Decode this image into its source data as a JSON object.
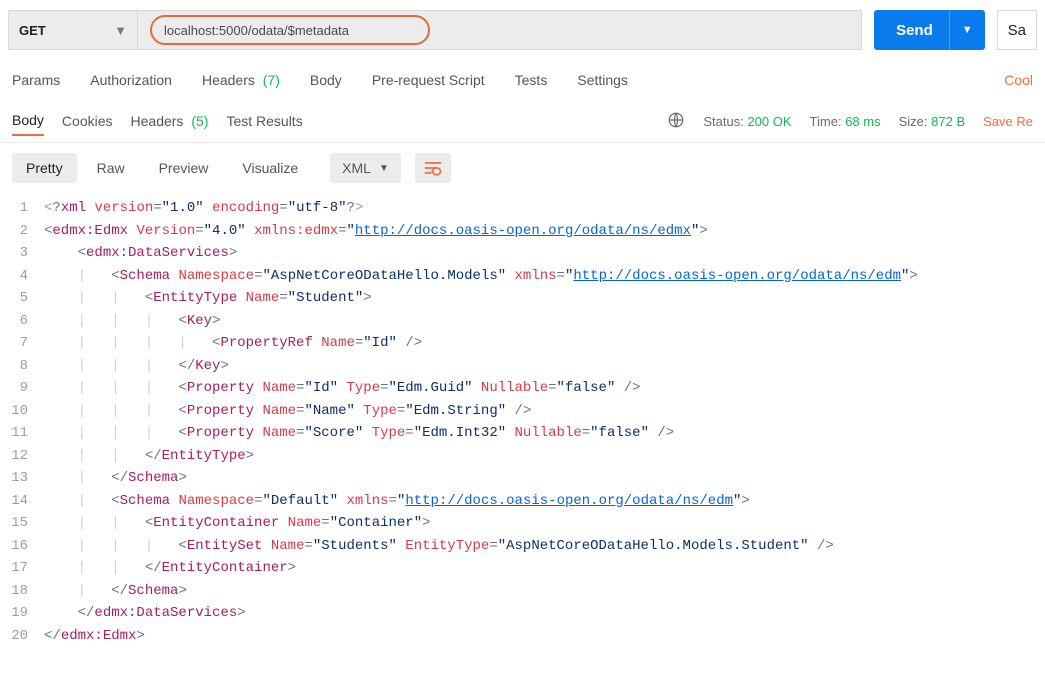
{
  "request": {
    "method": "GET",
    "url": "localhost:5000/odata/$metadata",
    "send_label": "Send",
    "save_label": "Sa"
  },
  "req_tabs": {
    "params": "Params",
    "auth": "Authorization",
    "headers": "Headers",
    "headers_count": "(7)",
    "body": "Body",
    "prereq": "Pre-request Script",
    "tests": "Tests",
    "settings": "Settings",
    "cookies_link": "Cool"
  },
  "res_tabs": {
    "body": "Body",
    "cookies": "Cookies",
    "headers": "Headers",
    "headers_count": "(5)",
    "test_results": "Test Results"
  },
  "res_meta": {
    "status_label": "Status:",
    "status_value": "200 OK",
    "time_label": "Time:",
    "time_value": "68 ms",
    "size_label": "Size:",
    "size_value": "872 B",
    "save_res": "Save Re"
  },
  "res_view": {
    "pretty": "Pretty",
    "raw": "Raw",
    "preview": "Preview",
    "visualize": "Visualize",
    "format": "XML"
  },
  "xml": {
    "decl_version": "\"1.0\"",
    "decl_encoding": "\"utf-8\"",
    "edmx_version": "\"4.0\"",
    "edmx_ns": "http://docs.oasis-open.org/odata/ns/edmx",
    "schema1_ns": "\"AspNetCoreODataHello.Models\"",
    "edm_ns": "http://docs.oasis-open.org/odata/ns/edm",
    "entitytype_name": "\"Student\"",
    "propref_name": "\"Id\"",
    "prop_id_name": "\"Id\"",
    "prop_id_type": "\"Edm.Guid\"",
    "prop_id_nullable": "\"false\"",
    "prop_name_name": "\"Name\"",
    "prop_name_type": "\"Edm.String\"",
    "prop_score_name": "\"Score\"",
    "prop_score_type": "\"Edm.Int32\"",
    "prop_score_nullable": "\"false\"",
    "schema2_ns": "\"Default\"",
    "container_name": "\"Container\"",
    "entityset_name": "\"Students\"",
    "entityset_type": "\"AspNetCoreODataHello.Models.Student\""
  },
  "line_numbers": [
    "1",
    "2",
    "3",
    "4",
    "5",
    "6",
    "7",
    "8",
    "9",
    "10",
    "11",
    "12",
    "13",
    "14",
    "15",
    "16",
    "17",
    "18",
    "19",
    "20"
  ]
}
